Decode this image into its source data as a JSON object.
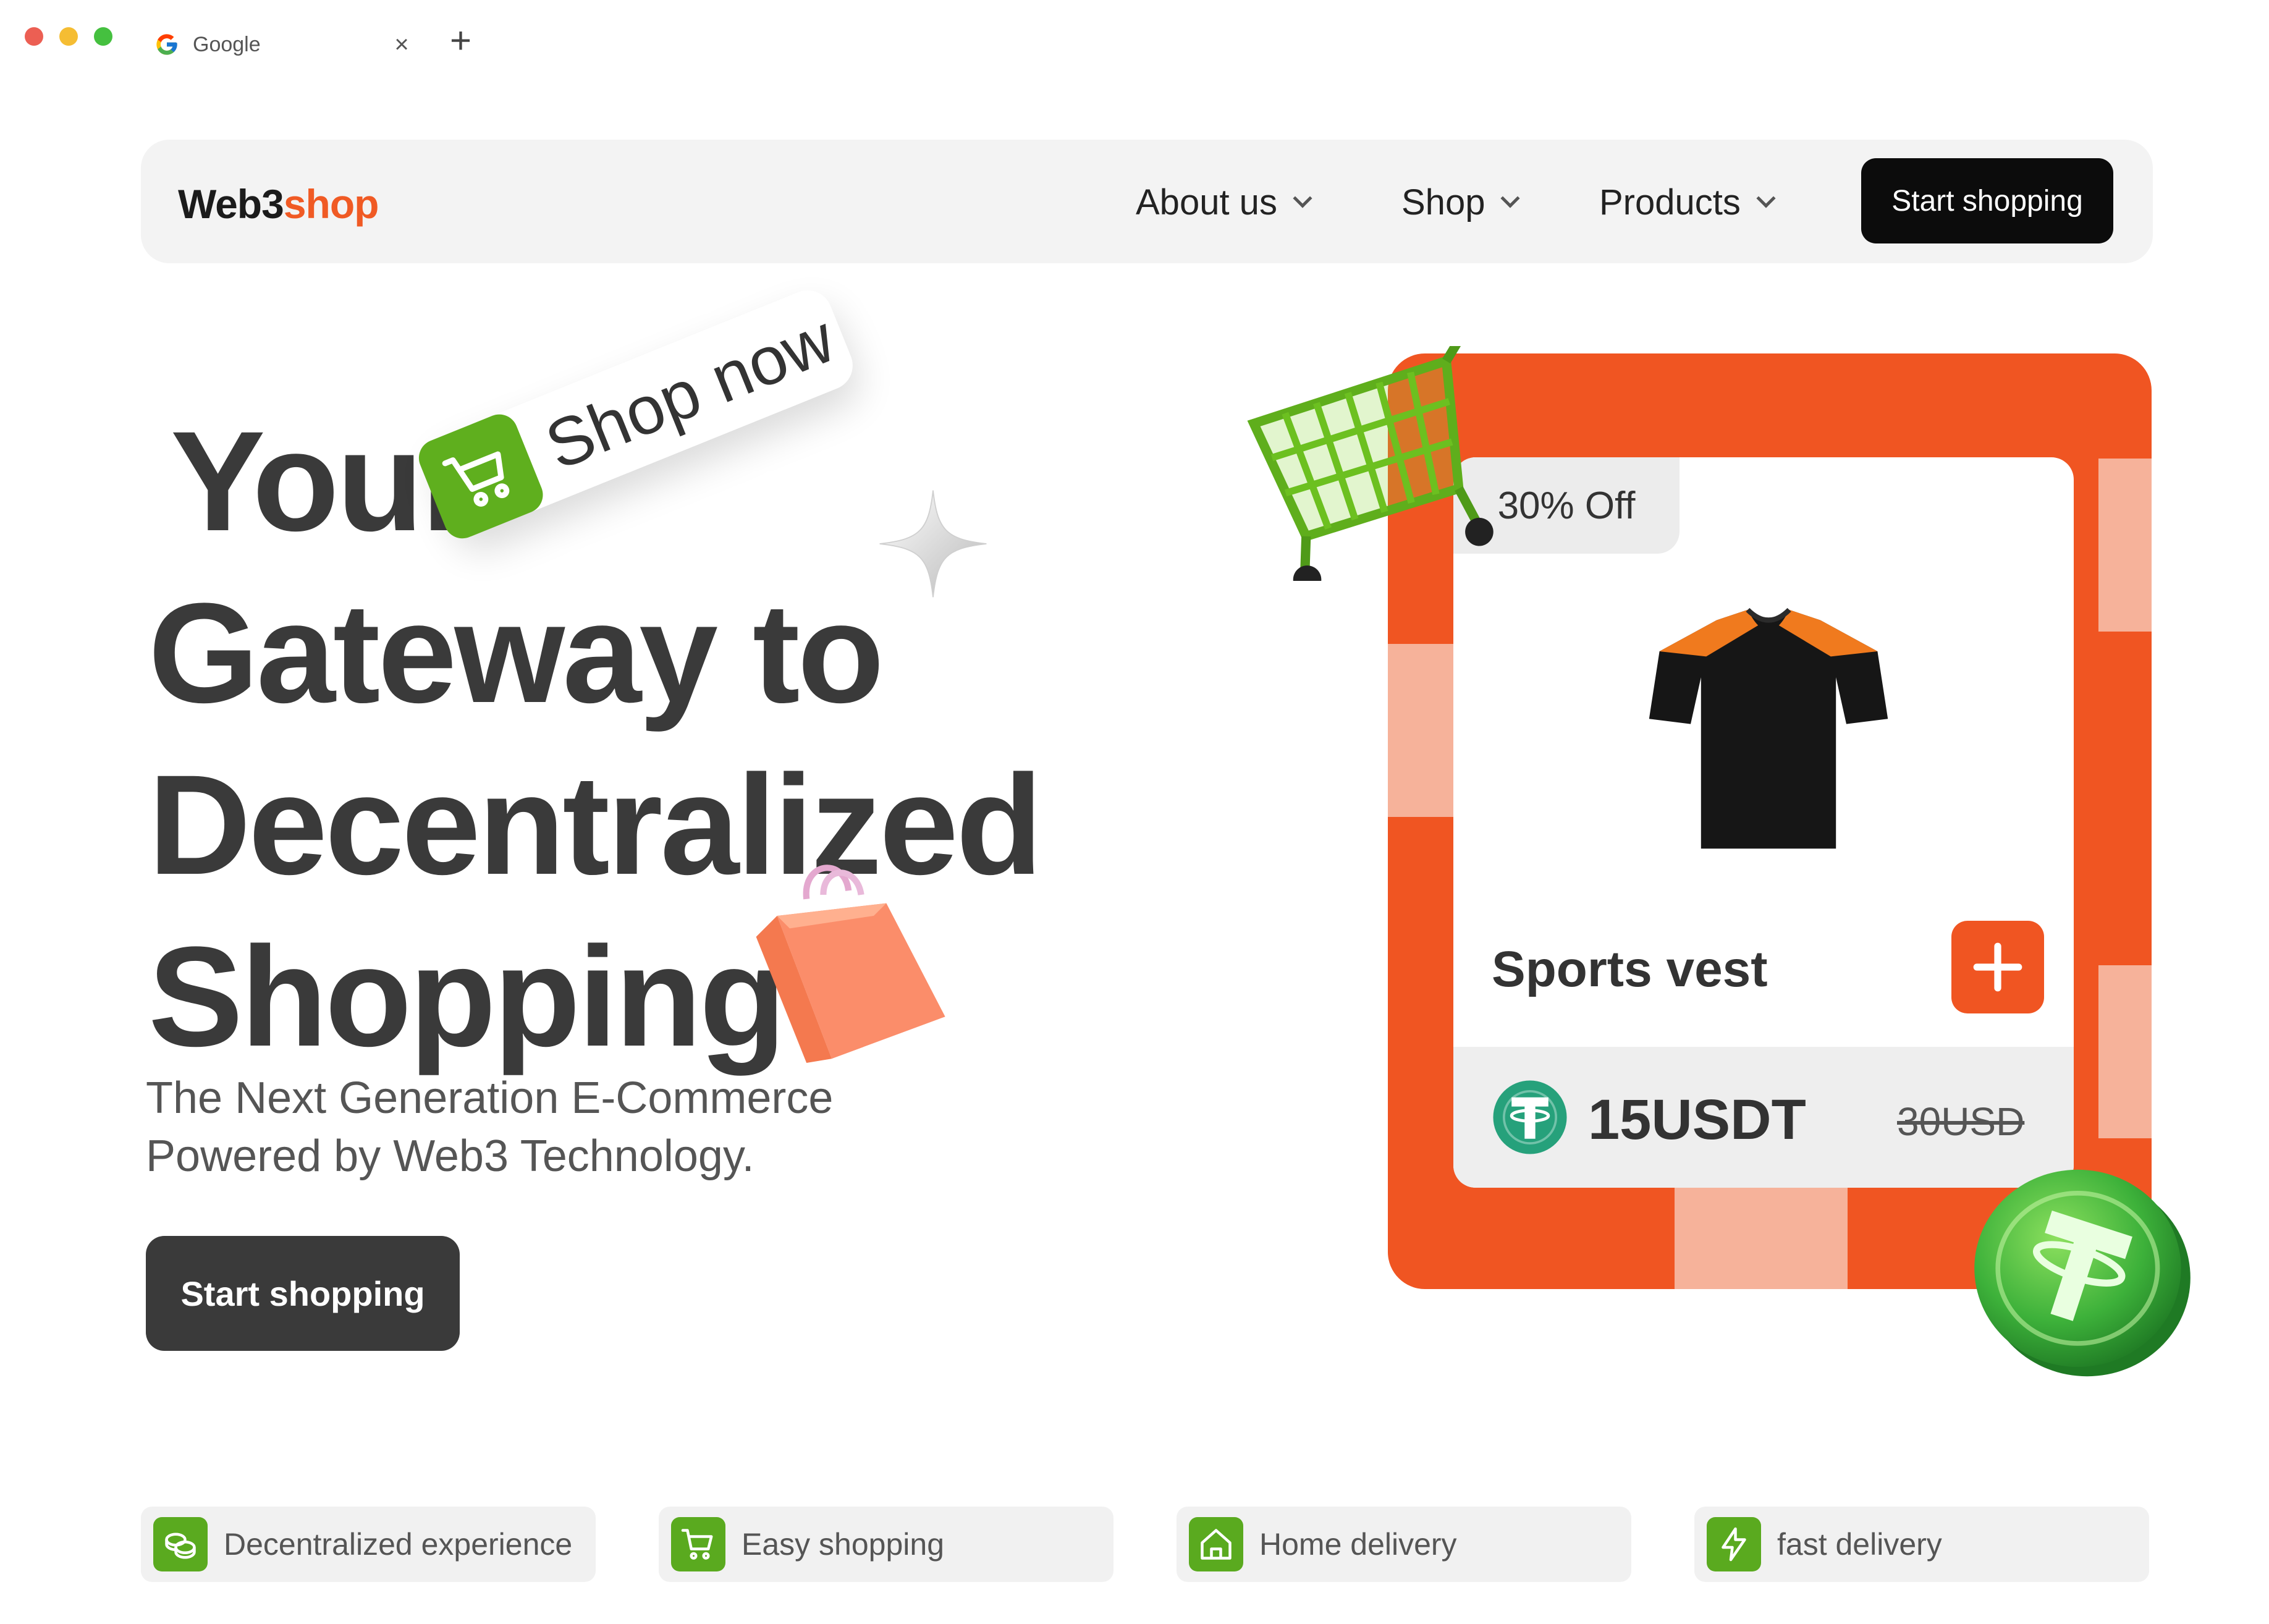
{
  "browser": {
    "tab_title": "Google",
    "close_glyph": "×",
    "new_tab_glyph": "+",
    "traffic_colors": [
      "#ec5f53",
      "#f5bd33",
      "#45c03f"
    ]
  },
  "navbar": {
    "logo_dark": "Web3",
    "logo_accent": "shop",
    "links": [
      {
        "label": "About us",
        "icon": "chevron-down-icon"
      },
      {
        "label": "Shop",
        "icon": "chevron-down-icon"
      },
      {
        "label": "Products",
        "icon": "chevron-down-icon"
      }
    ],
    "cta_label": "Start shopping"
  },
  "hero": {
    "title_lines": [
      "Your",
      "Gateway to",
      "Decentralized",
      "Shopping"
    ],
    "badge_label": "Shop now",
    "subtitle_lines": [
      "The Next Generation E-Commerce",
      "Powered by Web3 Technology."
    ],
    "cta_label": "Start shopping"
  },
  "product_card": {
    "discount": "30% Off",
    "name": "Sports vest",
    "price": "15USDT",
    "old_price": "30USD",
    "add_glyph": "+"
  },
  "features": [
    {
      "label": "Decentralized experience",
      "icon": "coins-icon"
    },
    {
      "label": "Easy shopping",
      "icon": "cart-icon"
    },
    {
      "label": "Home delivery",
      "icon": "home-icon"
    },
    {
      "label": "fast delivery",
      "icon": "lightning-icon"
    }
  ],
  "colors": {
    "brand_orange": "#f05522",
    "brand_green": "#5aaa1f",
    "dark": "#3a3a3a"
  }
}
